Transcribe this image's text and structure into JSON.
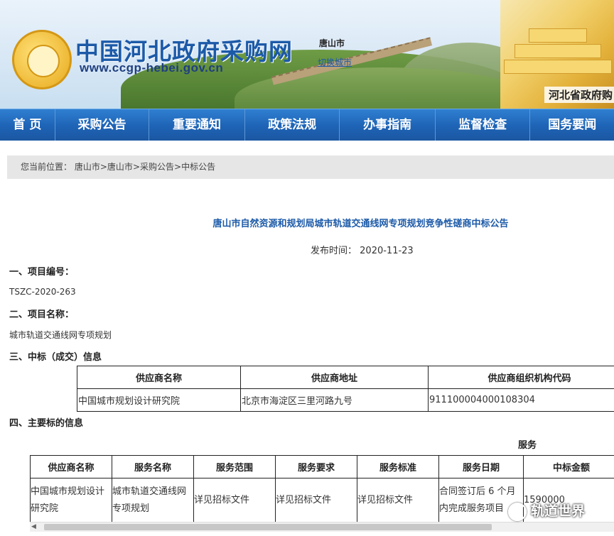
{
  "header": {
    "site_title": "中国河北政府采购网",
    "site_url": "www.ccgp-hebei.gov.cn",
    "city": "唐山市",
    "switch_city": "切换城市",
    "province": "河北省政府购"
  },
  "nav": {
    "items": [
      "首 页",
      "采购公告",
      "重要通知",
      "政策法规",
      "办事指南",
      "监督检查",
      "国务要闻"
    ]
  },
  "breadcrumb": {
    "label": "您当前位置：",
    "items": [
      "唐山市",
      "唐山市",
      "采购公告",
      "中标公告"
    ],
    "sep": ">"
  },
  "article": {
    "title": "唐山市自然资源和规划局城市轨道交通线网专项规划竞争性磋商中标公告",
    "publish_label": "发布时间：",
    "publish_date": "2020-11-23",
    "sec1": "一、项目编号：",
    "project_no": "TSZC-2020-263",
    "sec2": "二、项目名称：",
    "project_name": "城市轨道交通线网专项规划",
    "sec3": "三、中标（成交）信息",
    "sec4": "四、主要标的信息",
    "service_label": "服务"
  },
  "supplier_table": {
    "headers": [
      "供应商名称",
      "供应商地址",
      "供应商组织机构代码"
    ],
    "row": [
      "中国城市规划设计研究院",
      "北京市海淀区三里河路九号",
      "911100004000108304"
    ]
  },
  "service_table": {
    "headers": [
      "供应商名称",
      "服务名称",
      "服务范围",
      "服务要求",
      "服务标准",
      "服务日期",
      "中标金额"
    ],
    "row": [
      "中国城市规划设计研究院",
      "城市轨道交通线网专项规划",
      "详见招标文件",
      "详见招标文件",
      "详见招标文件",
      "合同签订后 6 个月内完成服务项目",
      "1590000"
    ]
  },
  "watermark": "轨道世界"
}
